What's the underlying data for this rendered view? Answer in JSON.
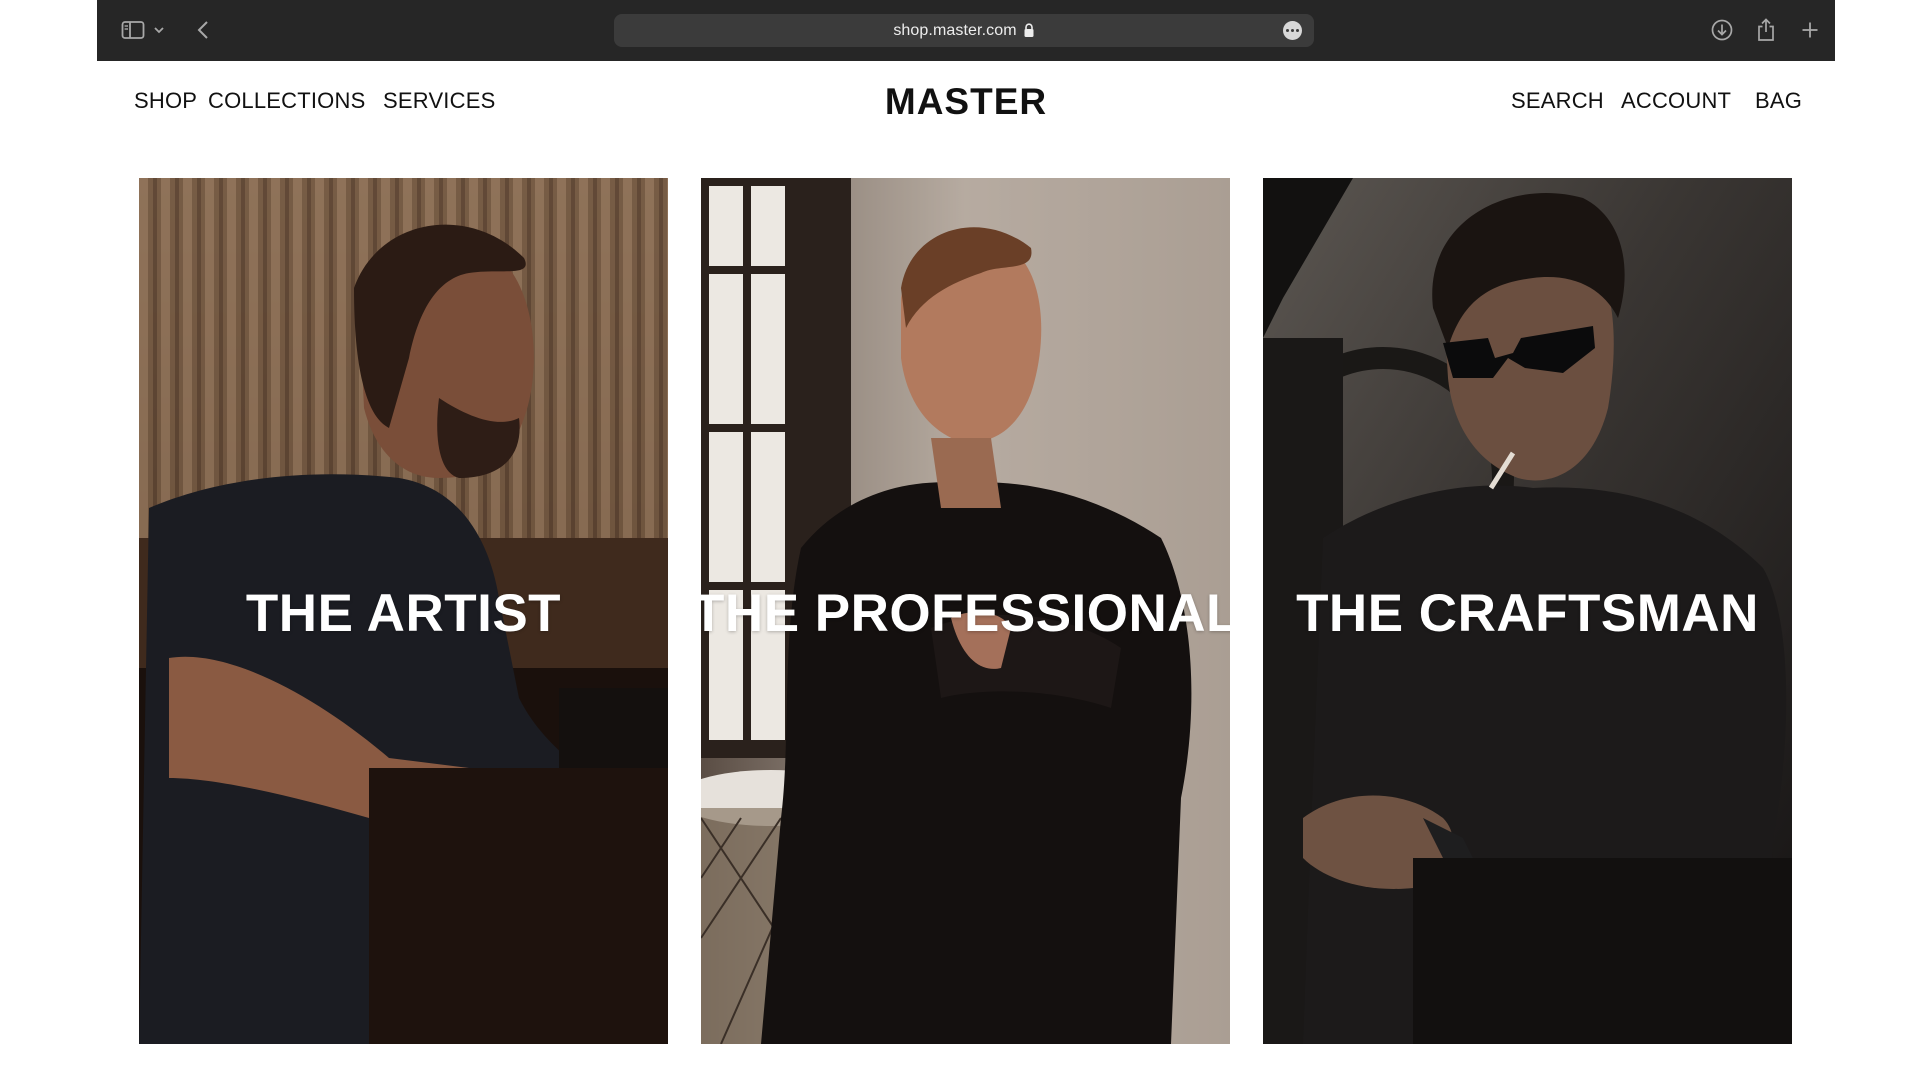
{
  "browser": {
    "url": "shop.master.com",
    "icons": {
      "sidebar": "sidebar-icon",
      "sidebar_menu": "chevron-down-icon",
      "back": "chevron-left-icon",
      "lock": "lock-icon",
      "more": "more-icon",
      "downloads": "download-icon",
      "share": "share-icon",
      "new_tab": "plus-icon"
    },
    "toolbar_color": "#262626"
  },
  "header": {
    "nav_left": [
      "SHOP",
      "COLLECTIONS",
      "SERVICES"
    ],
    "brand": "MASTER",
    "nav_right": [
      "SEARCH",
      "ACCOUNT",
      "BAG"
    ]
  },
  "collections": [
    {
      "title": "THE ARTIST"
    },
    {
      "title": "THE PROFESSIONAL"
    },
    {
      "title": "THE CRAFTSMAN"
    }
  ]
}
